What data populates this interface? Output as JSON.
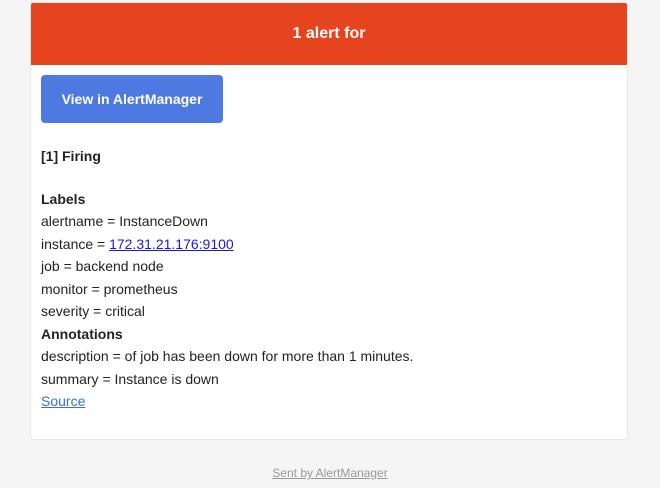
{
  "header": {
    "title": "1 alert for"
  },
  "button": {
    "label": "View in AlertManager"
  },
  "alert": {
    "firing_title": "[1] Firing",
    "labels_title": "Labels",
    "alertname_prefix": "alertname = ",
    "alertname_value": "InstanceDown",
    "instance_prefix": "instance = ",
    "instance_value": "172.31.21.176:9100",
    "job_prefix": "job = ",
    "job_value": "backend node",
    "monitor_prefix": "monitor = ",
    "monitor_value": "prometheus",
    "severity_prefix": "severity = ",
    "severity_value": "critical",
    "annotations_title": "Annotations",
    "description_prefix": "description = ",
    "description_value": "of job has been down for more than 1 minutes.",
    "summary_prefix": "summary = ",
    "summary_value": "Instance is down",
    "source_label": "Source"
  },
  "footer": {
    "text": "Sent by AlertManager"
  },
  "colors": {
    "header_bg": "#e6431f",
    "button_bg": "#4e79e0",
    "link": "#1a1ad6",
    "page_bg": "#f5f5f5"
  }
}
